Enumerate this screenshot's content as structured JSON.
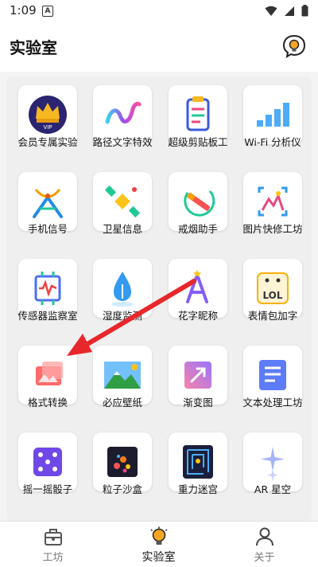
{
  "status_bar": {
    "time": "1:09",
    "notif_letter": "A"
  },
  "header": {
    "title": "实验室"
  },
  "tiles": [
    {
      "label": "会员专属实验",
      "icon": "vip-crown-icon"
    },
    {
      "label": "路径文字特效",
      "icon": "path-text-icon"
    },
    {
      "label": "超级剪贴板工",
      "icon": "clipboard-icon"
    },
    {
      "label": "Wi-Fi 分析仪",
      "icon": "wifi-bars-icon"
    },
    {
      "label": "手机信号",
      "icon": "signal-tower-icon"
    },
    {
      "label": "卫星信息",
      "icon": "satellite-icon"
    },
    {
      "label": "戒烟助手",
      "icon": "no-smoking-icon"
    },
    {
      "label": "图片快修工坊",
      "icon": "image-fix-icon"
    },
    {
      "label": "传感器监察室",
      "icon": "sensor-chip-icon"
    },
    {
      "label": "湿度监测",
      "icon": "humidity-drop-icon"
    },
    {
      "label": "花字昵称",
      "icon": "fancy-letter-icon"
    },
    {
      "label": "表情包加字",
      "icon": "meme-text-icon"
    },
    {
      "label": "格式转换",
      "icon": "format-convert-icon"
    },
    {
      "label": "必应壁纸",
      "icon": "bing-wallpaper-icon"
    },
    {
      "label": "渐变图",
      "icon": "gradient-image-icon"
    },
    {
      "label": "文本处理工坊",
      "icon": "text-process-icon"
    },
    {
      "label": "摇一摇骰子",
      "icon": "dice-icon"
    },
    {
      "label": "粒子沙盒",
      "icon": "particle-sandbox-icon"
    },
    {
      "label": "重力迷宫",
      "icon": "gravity-maze-icon"
    },
    {
      "label": "AR 星空",
      "icon": "ar-stars-icon"
    }
  ],
  "nav": {
    "workshop": "工坊",
    "lab": "实验室",
    "about": "关于"
  },
  "colors": {
    "accent_arrow": "#e8272b",
    "active_nav": "#111111",
    "inactive_nav": "#777777"
  }
}
